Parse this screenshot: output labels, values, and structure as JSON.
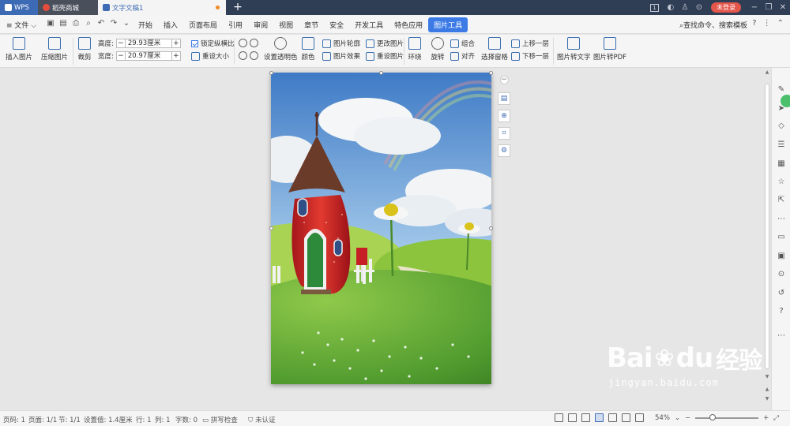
{
  "titlebar": {
    "tabs": [
      {
        "label": "WPS",
        "icon": "wps-logo-icon"
      },
      {
        "label": "稻壳商城",
        "icon": "daoke-icon"
      },
      {
        "label": "文字文稿1",
        "icon": "document-icon"
      }
    ],
    "login_label": "未登录"
  },
  "menubar": {
    "file_label": "文件",
    "items": [
      "开始",
      "插入",
      "页面布局",
      "引用",
      "审阅",
      "视图",
      "章节",
      "安全",
      "开发工具",
      "特色应用",
      "图片工具"
    ],
    "active_item": "图片工具",
    "search_label": "查找命令、搜索模板"
  },
  "ribbon": {
    "insert_picture": "插入图片",
    "compress_picture": "压缩图片",
    "crop": "裁剪",
    "height_label": "高度:",
    "height_value": "29.93厘米",
    "width_label": "宽度:",
    "width_value": "20.97厘米",
    "lock_ratio": "锁定纵横比",
    "reset_size": "重设大小",
    "set_transparent": "设置透明色",
    "color": "颜色",
    "picture_outline": "图片轮廓",
    "picture_effect": "图片效果",
    "change_picture": "更改图片",
    "reset_picture": "重设图片",
    "wrap": "环绕",
    "rotate": "旋转",
    "group": "组合",
    "align": "对齐",
    "select_pane": "选择窗格",
    "bring_forward": "上移一层",
    "send_backward": "下移一层",
    "picture_to_text": "图片转文字",
    "picture_to_pdf": "图片转PDF"
  },
  "statusbar": {
    "page_num": "页码: 1",
    "pages": "页面: 1/1",
    "section": "节: 1/1",
    "setting_value": "设置值: 1.4厘米",
    "row": "行: 1",
    "col": "列: 1",
    "word_count": "字数: 0",
    "spell_check": "拼写检查",
    "uncertified": "未认证",
    "zoom": "54%"
  },
  "watermark": {
    "brand": "Bai",
    "brand2": "du",
    "cn": "经验",
    "url": "jingyan.baidu.com"
  },
  "colors": {
    "accent": "#3c7be6",
    "titlebar": "#2f3d55",
    "login": "#e4554a"
  }
}
